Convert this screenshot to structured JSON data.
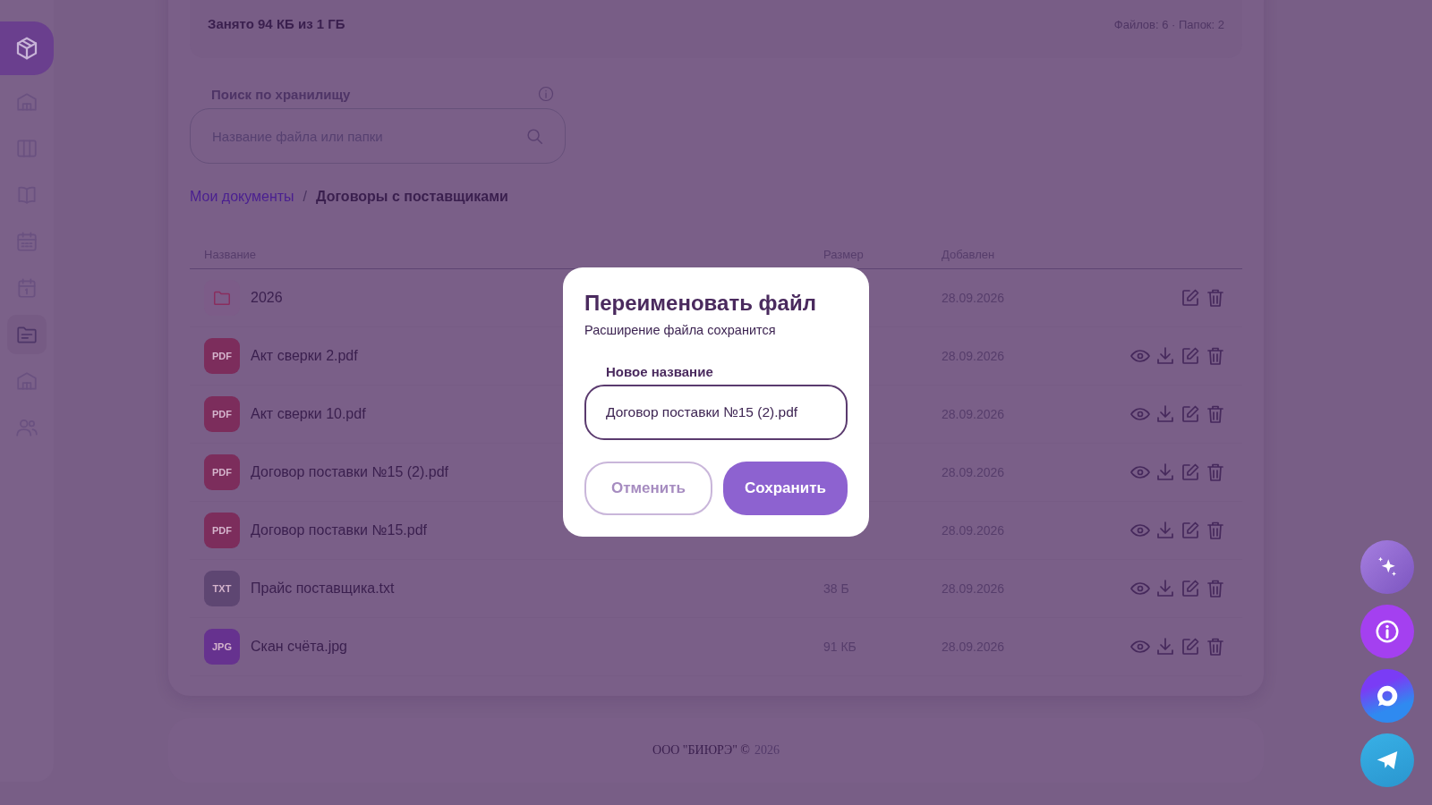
{
  "sidebar": {
    "items": [
      {
        "kind": "warehouse",
        "selected": false
      },
      {
        "kind": "board",
        "selected": false
      },
      {
        "kind": "book",
        "selected": false
      },
      {
        "kind": "calendar",
        "selected": false
      },
      {
        "kind": "calendar-day",
        "selected": false
      },
      {
        "kind": "documents",
        "selected": true
      },
      {
        "kind": "warehouse",
        "selected": false
      },
      {
        "kind": "users",
        "selected": false
      }
    ]
  },
  "storage": {
    "used": "Занято 94 КБ из 1 ГБ",
    "counts": "Файлов: 6 · Папок: 2"
  },
  "search": {
    "label": "Поиск по хранилищу",
    "placeholder": "Название файла или папки"
  },
  "breadcrumb": {
    "separator": "/",
    "items": [
      {
        "label": "Мои документы",
        "selected": false
      },
      {
        "label": "Договоры с поставщиками",
        "selected": true
      }
    ]
  },
  "table": {
    "columns": [
      "Название",
      "Размер",
      "Добавлен"
    ],
    "rows": [
      {
        "kind": "folder",
        "name": "2026",
        "added": "28.09.2026"
      },
      {
        "kind": "file",
        "badge": "PDF",
        "color": "#7c2d5c",
        "name": "Акт сверки 2.pdf",
        "added": "28.09.2026"
      },
      {
        "kind": "file",
        "badge": "PDF",
        "color": "#7c2d5c",
        "name": "Акт сверки 10.pdf",
        "added": "28.09.2026"
      },
      {
        "kind": "file",
        "badge": "PDF",
        "color": "#7c2d5c",
        "name": "Договор поставки №15 (2).pdf",
        "added": "28.09.2026"
      },
      {
        "kind": "file",
        "badge": "PDF",
        "color": "#7c2d5c",
        "name": "Договор поставки №15.pdf",
        "added": "28.09.2026"
      },
      {
        "kind": "file",
        "badge": "TXT",
        "color": "#5e4672",
        "name": "Прайс поставщика.txt",
        "size": "38 Б",
        "added": "28.09.2026"
      },
      {
        "kind": "file",
        "badge": "JPG",
        "color": "#66328f",
        "name": "Скан счёта.jpg",
        "size": "91 КБ",
        "added": "28.09.2026"
      }
    ]
  },
  "footer": {
    "company": "ООО \"БИЮРЭ\" ©",
    "year": "2026"
  },
  "dialog": {
    "title": "Переименовать файл",
    "subtitle": "Расширение файла сохранится",
    "field_label": "Новое название",
    "value": "Договор поставки №15 (2).pdf",
    "buttons": [
      {
        "label": "Отменить",
        "kind": "secondary"
      },
      {
        "label": "Сохранить",
        "kind": "primary"
      }
    ]
  },
  "floating_buttons": [
    {
      "kind": "sparkle"
    },
    {
      "kind": "info"
    },
    {
      "kind": "chat"
    },
    {
      "kind": "send"
    }
  ]
}
